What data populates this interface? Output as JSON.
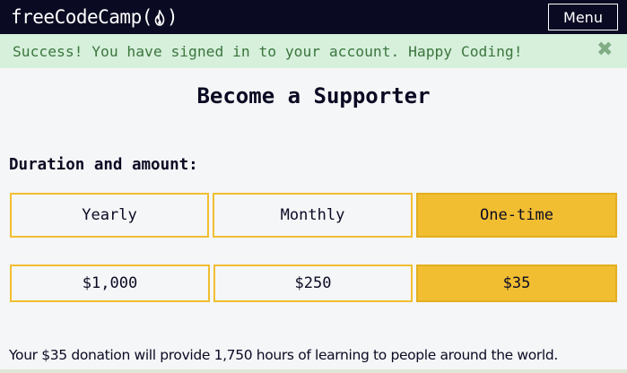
{
  "navbar": {
    "logo_text": "freeCodeCamp",
    "logo_open": "(",
    "logo_close": ")",
    "logo_icon": "flame-icon",
    "menu_label": "Menu"
  },
  "flash": {
    "message": "Success! You have signed in to your account. Happy Coding!",
    "close_icon": "close-icon",
    "close_glyph": "✖"
  },
  "page": {
    "title": "Become a Supporter",
    "duration_label": "Duration and amount:",
    "durations": [
      {
        "label": "Yearly",
        "selected": false
      },
      {
        "label": "Monthly",
        "selected": false
      },
      {
        "label": "One-time",
        "selected": true
      }
    ],
    "amounts": [
      {
        "label": "$1,000",
        "selected": false
      },
      {
        "label": "$250",
        "selected": false
      },
      {
        "label": "$35",
        "selected": true
      }
    ],
    "donation_text": "Your $35 donation will provide 1,750 hours of learning to people around the world."
  },
  "colors": {
    "navbar_bg": "#0a0a23",
    "accent_yellow": "#f1be32",
    "flash_bg": "#d6f0dc",
    "flash_text": "#3c763d",
    "page_bg": "#f5f6f7"
  }
}
